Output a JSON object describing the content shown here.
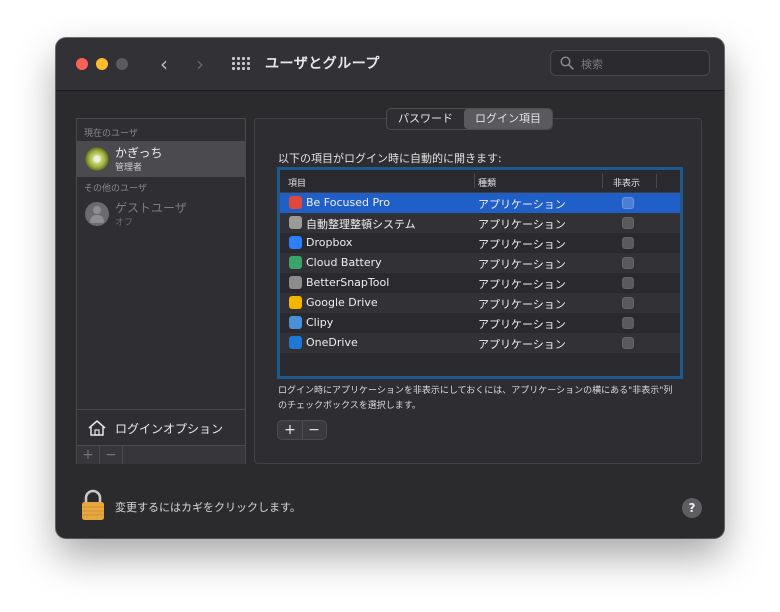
{
  "window": {
    "title": "ユーザとグループ",
    "search_placeholder": "検索"
  },
  "sidebar": {
    "current_user_header": "現在のユーザ",
    "current_user": {
      "name": "かぎっち",
      "role": "管理者"
    },
    "other_users_header": "その他のユーザ",
    "other_users": [
      {
        "name": "ゲストユーザ",
        "status": "オフ"
      }
    ],
    "login_options_label": "ログインオプション",
    "add_label": "+",
    "remove_label": "−"
  },
  "tabs": [
    {
      "label": "パスワード",
      "active": false
    },
    {
      "label": "ログイン項目",
      "active": true
    }
  ],
  "login_items": {
    "intro": "以下の項目がログイン時に自動的に開きます:",
    "columns": {
      "item": "項目",
      "kind": "種類",
      "hide": "非表示"
    },
    "rows": [
      {
        "name": "Be Focused Pro",
        "kind": "アプリケーション",
        "icon": "be-focused-pro-icon",
        "icon_color": "#e0483e",
        "hidden": false,
        "selected": true
      },
      {
        "name": "自動整理整頓システム",
        "kind": "アプリケーション",
        "icon": "auto-organize-icon",
        "icon_color": "#9a9a9a",
        "hidden": false,
        "selected": false
      },
      {
        "name": "Dropbox",
        "kind": "アプリケーション",
        "icon": "dropbox-icon",
        "icon_color": "#2d7ff9",
        "hidden": false,
        "selected": false
      },
      {
        "name": "Cloud Battery",
        "kind": "アプリケーション",
        "icon": "cloud-battery-icon",
        "icon_color": "#3aa46a",
        "hidden": false,
        "selected": false
      },
      {
        "name": "BetterSnapTool",
        "kind": "アプリケーション",
        "icon": "bettersnaptool-icon",
        "icon_color": "#8c8c8c",
        "hidden": false,
        "selected": false
      },
      {
        "name": "Google Drive",
        "kind": "アプリケーション",
        "icon": "google-drive-icon",
        "icon_color": "#f4b400",
        "hidden": false,
        "selected": false
      },
      {
        "name": "Clipy",
        "kind": "アプリケーション",
        "icon": "clipy-icon",
        "icon_color": "#4a90d9",
        "hidden": false,
        "selected": false
      },
      {
        "name": "OneDrive",
        "kind": "アプリケーション",
        "icon": "onedrive-icon",
        "icon_color": "#1e78d4",
        "hidden": false,
        "selected": false
      }
    ],
    "note": "ログイン時にアプリケーションを非表示にしておくには、アプリケーションの横にある\"非表示\"列のチェックボックスを選択します。",
    "add_label": "+",
    "remove_label": "−"
  },
  "footer": {
    "lock_text": "変更するにはカギをクリックします。",
    "help_label": "?"
  },
  "colors": {
    "selection": "#1f5fc7",
    "table_focus_ring": "#1e5a8e",
    "close": "#ff5f57",
    "minimize": "#febc2e",
    "lock": "#e8a640"
  }
}
